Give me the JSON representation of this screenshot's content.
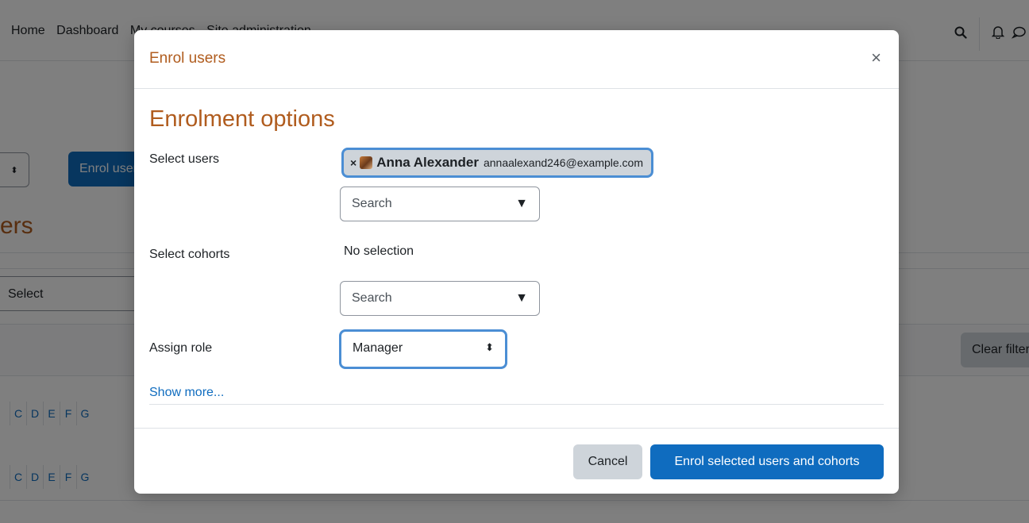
{
  "background": {
    "nav_items": [
      "Home",
      "Dashboard",
      "My courses",
      "Site administration"
    ],
    "enrol_button_label": "Enrol users",
    "select_arrow_glyph": "⬍",
    "heading": "ers",
    "select_label": "Select",
    "clear_filters_label": "Clear filters",
    "letters_row1": [
      "C",
      "D",
      "E",
      "F",
      "G"
    ],
    "letters_row2": [
      "C",
      "D",
      "E",
      "F",
      "G"
    ],
    "icons": {
      "search": "search-icon",
      "notifications": "bell-icon",
      "messages": "chat-bubble-icon"
    }
  },
  "modal": {
    "title": "Enrol users",
    "close_glyph": "×",
    "section_title": "Enrolment options",
    "select_users": {
      "label": "Select users",
      "selected_user": {
        "remove_glyph": "×",
        "name": "Anna Alexander",
        "email": "annaalexand246@example.com"
      },
      "search_placeholder": "Search",
      "dropdown_glyph": "▼"
    },
    "select_cohorts": {
      "label": "Select cohorts",
      "selection_text": "No selection",
      "search_placeholder": "Search",
      "dropdown_glyph": "▼"
    },
    "assign_role": {
      "label": "Assign role",
      "value": "Manager",
      "caret_glyph": "⬍"
    },
    "show_more": "Show more...",
    "footer": {
      "cancel_label": "Cancel",
      "submit_label": "Enrol selected users and cohorts"
    }
  },
  "colors": {
    "brand_primary": "#0f6cbf",
    "heading_orange": "#b05c1e",
    "focus_ring": "#4b8ed4",
    "secondary_button": "#ced4da"
  }
}
